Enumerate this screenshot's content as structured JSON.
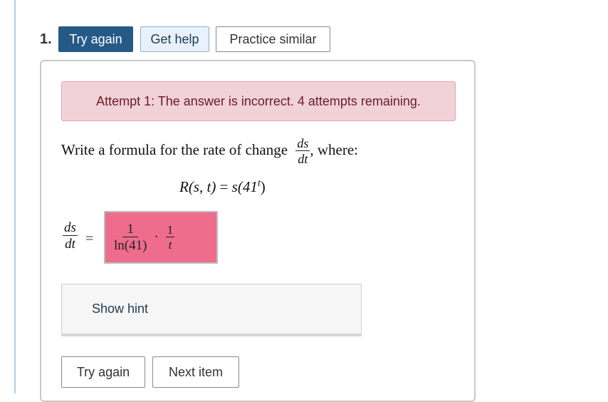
{
  "question": {
    "number": "1.",
    "top_buttons": {
      "try_again": "Try again",
      "get_help": "Get help",
      "practice_similar": "Practice similar"
    }
  },
  "alert": {
    "text": "Attempt 1: The answer is incorrect. 4 attempts remaining."
  },
  "prompt": {
    "text_before": "Write a formula for the rate of change",
    "rate_num": "ds",
    "rate_den": "dt",
    "text_after": ", where:"
  },
  "equation": {
    "lhs": "R(s, t)",
    "equals": "=",
    "rhs_base": "s(41",
    "rhs_exp": "t",
    "rhs_close": ")"
  },
  "answer": {
    "lhs_num": "ds",
    "lhs_den": "dt",
    "equals": "=",
    "frac1_num": "1",
    "frac1_den": "ln(41)",
    "dot": "·",
    "frac2_num": "1",
    "frac2_den": "t"
  },
  "hint": {
    "label": "Show hint"
  },
  "bottom_buttons": {
    "try_again": "Try again",
    "next_item": "Next item"
  },
  "colors": {
    "primary": "#255a87",
    "alert_bg": "#f1d2d8",
    "answer_incorrect": "#ee6c8c",
    "left_rule": "#a9cdf0"
  }
}
